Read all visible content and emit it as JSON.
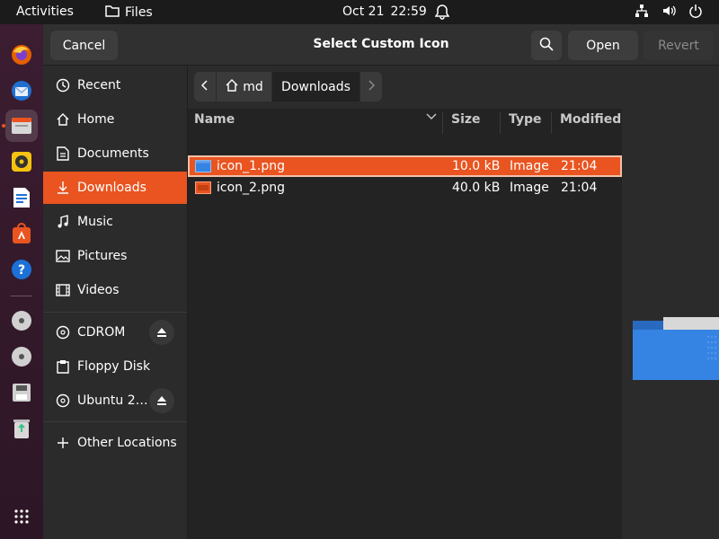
{
  "topbar": {
    "activities": "Activities",
    "app_name": "Files",
    "date": "Oct 21",
    "time": "22:59"
  },
  "dock": {
    "items": [
      "firefox-icon",
      "thunderbird-icon",
      "files-icon",
      "rhythmbox-icon",
      "writer-icon",
      "software-icon",
      "help-icon",
      "cdrom-icon",
      "dvd-icon",
      "floppy-icon",
      "trash-icon",
      "apps-grid-icon"
    ]
  },
  "dialog": {
    "title": "Select Custom Icon",
    "cancel_label": "Cancel",
    "open_label": "Open",
    "revert_label": "Revert"
  },
  "sidebar": {
    "places": [
      "Recent",
      "Home",
      "Documents",
      "Downloads",
      "Music",
      "Pictures",
      "Videos"
    ],
    "devices": [
      "CDROM",
      "Floppy Disk",
      "Ubuntu 2…"
    ],
    "other": "Other Locations",
    "selected": "Downloads"
  },
  "pathbar": {
    "home": "md",
    "current": "Downloads"
  },
  "filelist": {
    "headers": {
      "name": "Name",
      "size": "Size",
      "type": "Type",
      "modified": "Modified"
    },
    "rows": [
      {
        "name": "icon_1.png",
        "size": "10.0 kB",
        "type": "Image",
        "modified": "21:04",
        "selected": true
      },
      {
        "name": "icon_2.png",
        "size": "40.0 kB",
        "type": "Image",
        "modified": "21:04",
        "selected": false
      }
    ]
  },
  "colors": {
    "accent": "#e95420",
    "folder_blue": "#3584e4"
  }
}
